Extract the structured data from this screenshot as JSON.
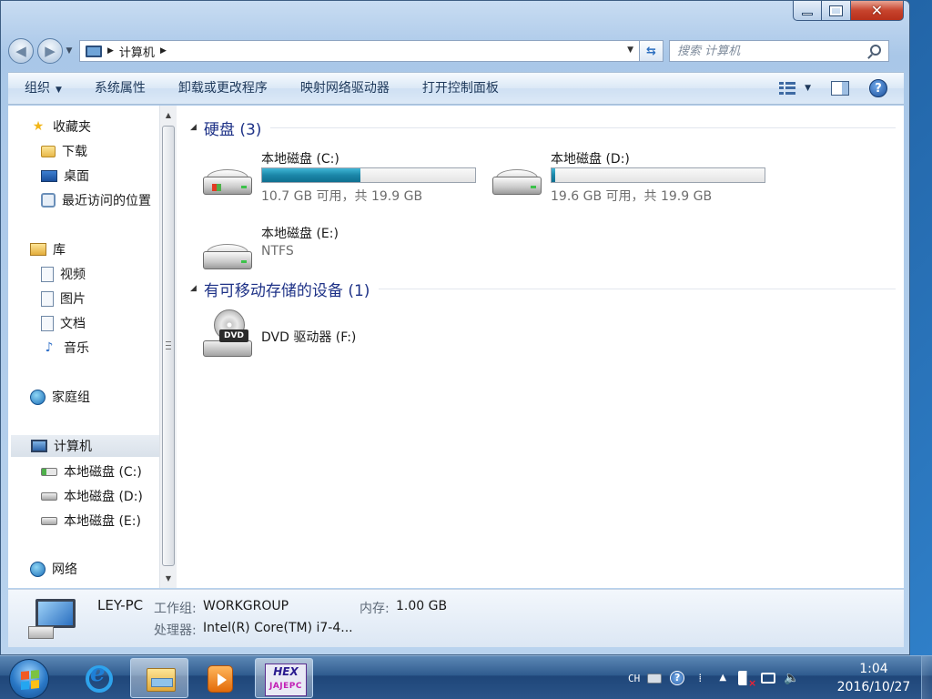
{
  "window": {
    "caption": {
      "minimize_icon": "minimize-icon",
      "maximize_icon": "maximize-icon",
      "close_glyph": "✕"
    },
    "address": {
      "breadcrumb_sep": "▶",
      "location": "计算机",
      "dropdown_glyph": "▼"
    },
    "search": {
      "placeholder": "搜索 计算机"
    },
    "toolbar": {
      "organize": "组织",
      "system_properties": "系统属性",
      "uninstall": "卸载或更改程序",
      "map_drive": "映射网络驱动器",
      "control_panel": "打开控制面板",
      "help": "?"
    },
    "nav": {
      "favorites": "收藏夹",
      "downloads": "下载",
      "desktop": "桌面",
      "recent": "最近访问的位置",
      "libraries": "库",
      "videos": "视频",
      "pictures": "图片",
      "documents": "文档",
      "music": "音乐",
      "homegroup": "家庭组",
      "computer": "计算机",
      "drive_c": "本地磁盘 (C:)",
      "drive_d": "本地磁盘 (D:)",
      "drive_e": "本地磁盘 (E:)",
      "network": "网络"
    },
    "groups": {
      "hard_disks": "硬盘 (3)",
      "removable": "有可移动存储的设备 (1)"
    },
    "drives": [
      {
        "name": "本地磁盘 (C:)",
        "free_text": "10.7 GB 可用，共 19.9 GB",
        "used_fraction": 0.46
      },
      {
        "name": "本地磁盘 (D:)",
        "free_text": "19.6 GB 可用，共 19.9 GB",
        "used_fraction": 0.015
      },
      {
        "name": "本地磁盘 (E:)",
        "filesystem": "NTFS"
      }
    ],
    "dvd": {
      "name": "DVD 驱动器 (F:)",
      "badge": "DVD"
    },
    "details": {
      "pc_name": "LEY-PC",
      "workgroup_label": "工作组:",
      "workgroup_value": "WORKGROUP",
      "memory_label": "内存:",
      "memory_value": "1.00 GB",
      "cpu_label": "处理器:",
      "cpu_value": "Intel(R) Core(TM) i7-4..."
    }
  },
  "taskbar": {
    "hex_app_top": "HEX",
    "hex_app_bottom": "JAJEPC",
    "tray_lang": "CH",
    "tray_help": "?",
    "clock_time": "1:04",
    "clock_date": "2016/10/27"
  },
  "colors": {
    "group_title": "#1e3287",
    "drive_bar_fill": "#1b86a8",
    "taskbar": "#2f5b8e"
  }
}
